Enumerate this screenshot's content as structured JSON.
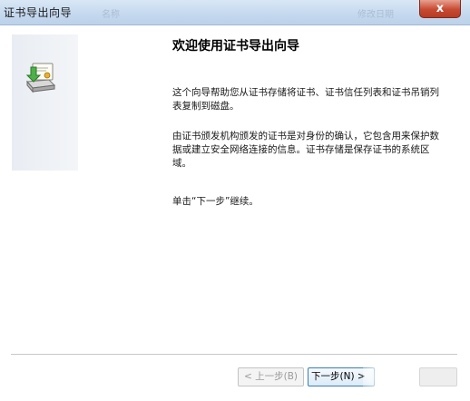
{
  "window": {
    "title": "证书导出向导",
    "ghost_header_left": "名称",
    "ghost_header_right": "修改日期",
    "close_label": "x"
  },
  "wizard": {
    "heading": "欢迎使用证书导出向导",
    "paragraph1": "这个向导帮助您从证书存储将证书、证书信任列表和证书吊销列表复制到磁盘。",
    "paragraph2": "由证书颁发机构颁发的证书是对身份的确认，它包含用来保护数据或建立安全网络连接的信息。证书存储是保存证书的系统区域。",
    "paragraph3": "单击“下一步”继续。"
  },
  "buttons": {
    "back_label": "< 上一步(B)",
    "next_label": "下一步(N) >",
    "back_enabled": false
  },
  "icons": {
    "wizard": "certificate-export-icon",
    "close": "close-icon"
  },
  "colors": {
    "titlebar": "#c4d8ee",
    "close_button": "#c74a32",
    "banner": "#eef1f5",
    "default_button_border": "#3c7fb1"
  }
}
